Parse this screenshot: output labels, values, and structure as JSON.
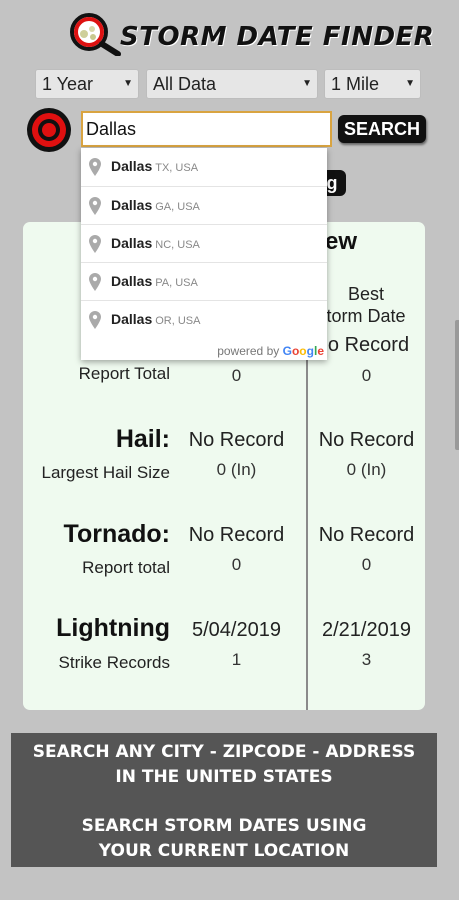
{
  "header": {
    "title": "STORM DATE FINDER",
    "logo_icon": "magnifier-hail-icon"
  },
  "filters": {
    "period": "1 Year",
    "data_type": "All Data",
    "radius": "1 Mile"
  },
  "search": {
    "value": "Dallas",
    "button_label": "SEARCH",
    "location_icon": "target-icon"
  },
  "suggestions": [
    {
      "city": "Dallas",
      "region": "TX, USA"
    },
    {
      "city": "Dallas",
      "region": "GA, USA"
    },
    {
      "city": "Dallas",
      "region": "NC, USA"
    },
    {
      "city": "Dallas",
      "region": "PA, USA"
    },
    {
      "city": "Dallas",
      "region": "OR, USA"
    }
  ],
  "powered_by": {
    "prefix": "powered by",
    "brand": [
      "G",
      "o",
      "o",
      "g",
      "l",
      "e"
    ]
  },
  "partial": {
    "button_text": "g",
    "col_header": "ew",
    "best_line1": "Best",
    "best_line2": "torm Date",
    "best_value": "o Record"
  },
  "table": {
    "wind": {
      "sub": "Report Total",
      "recent_count": "0",
      "best_count": "0"
    },
    "hail": {
      "title": "Hail:",
      "sub": "Largest Hail Size",
      "recent": "No Record",
      "best": "No Record",
      "recent_count": "0 (In)",
      "best_count": "0 (In)"
    },
    "tornado": {
      "title": "Tornado:",
      "sub": "Report total",
      "recent": "No Record",
      "best": "No Record",
      "recent_count": "0",
      "best_count": "0"
    },
    "lightning": {
      "title": "Lightning",
      "sub": "Strike Records",
      "recent": "5/04/2019",
      "best": "2/21/2019",
      "recent_count": "1",
      "best_count": "3"
    }
  },
  "info": {
    "line1": "SEARCH ANY CITY - ZIPCODE - ADDRESS",
    "line2": "IN THE UNITED STATES",
    "line3": "SEARCH STORM DATES USING",
    "line4": "YOUR CURRENT LOCATION"
  },
  "colors": {
    "panel_bg": "#effaef",
    "input_border": "#d9a441",
    "target_red": "#e01010",
    "info_bg": "#555555"
  }
}
